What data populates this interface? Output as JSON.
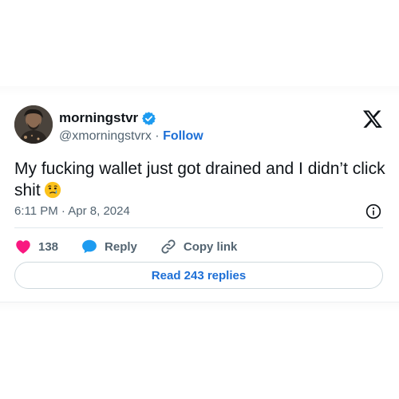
{
  "user": {
    "display_name": "morningstvr",
    "handle": "@xmorningstvrx",
    "separator": "·",
    "follow_label": "Follow"
  },
  "tweet": {
    "text": "My fucking wallet just got drained and I didn’t click shit",
    "timestamp": "6:11 PM · Apr 8, 2024"
  },
  "actions": {
    "like_count": "138",
    "reply_label": "Reply",
    "copy_link_label": "Copy link"
  },
  "read_replies_label": "Read 243 replies",
  "icons": {
    "verified": "verified-badge-icon",
    "logo": "x-logo-icon",
    "emoji": "face-holding-back-tears-emoji",
    "info": "info-icon",
    "like": "heart-icon",
    "reply": "speech-bubble-icon",
    "copy_link": "link-icon"
  },
  "colors": {
    "accent": "#1d9bf0",
    "link_text": "#1d6fd6",
    "like": "#f91880",
    "muted": "#536471"
  }
}
